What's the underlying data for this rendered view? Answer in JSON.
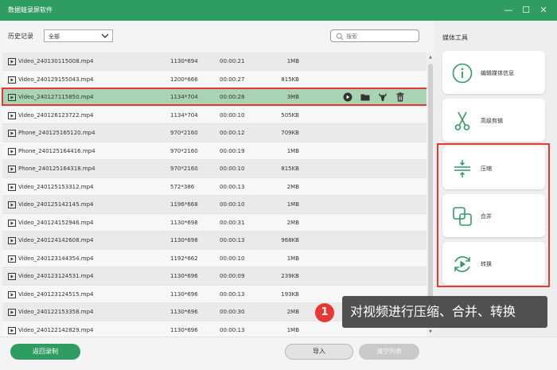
{
  "window": {
    "title": "数据蛙录屏软件",
    "minimize_glyph": "—",
    "maximize_glyph": "☐",
    "close_glyph": "✕"
  },
  "toolbar": {
    "history_label": "历史记录",
    "filter_value": "全部",
    "search_placeholder": "搜索"
  },
  "files": [
    {
      "name": "Video_240130115008.mp4",
      "resolution": "1130*694",
      "duration": "00:00:21",
      "size": "1MB"
    },
    {
      "name": "Video_240129155043.mp4",
      "resolution": "1200*666",
      "duration": "00:00:27",
      "size": "815KB"
    },
    {
      "name": "Video_240127115850.mp4",
      "resolution": "1134*704",
      "duration": "00:00:28",
      "size": "3MB"
    },
    {
      "name": "Video_240126123722.mp4",
      "resolution": "1134*704",
      "duration": "00:00:10",
      "size": "505KB"
    },
    {
      "name": "Phone_240125165120.mp4",
      "resolution": "970*2160",
      "duration": "00:00:12",
      "size": "709KB"
    },
    {
      "name": "Phone_240125164416.mp4",
      "resolution": "970*2160",
      "duration": "00:00:19",
      "size": "1MB"
    },
    {
      "name": "Phone_240125164318.mp4",
      "resolution": "970*2160",
      "duration": "00:00:10",
      "size": "815KB"
    },
    {
      "name": "Video_240125153312.mp4",
      "resolution": "572*386",
      "duration": "00:00:13",
      "size": "2MB"
    },
    {
      "name": "Video_240125142145.mp4",
      "resolution": "1196*668",
      "duration": "00:00:10",
      "size": "1MB"
    },
    {
      "name": "Video_240124152946.mp4",
      "resolution": "1130*698",
      "duration": "00:00:31",
      "size": "2MB"
    },
    {
      "name": "Video_240124142608.mp4",
      "resolution": "1130*698",
      "duration": "00:00:13",
      "size": "968KB"
    },
    {
      "name": "Video_240123144354.mp4",
      "resolution": "1192*662",
      "duration": "00:00:10",
      "size": "1MB"
    },
    {
      "name": "Video_240123124531.mp4",
      "resolution": "1130*696",
      "duration": "00:00:09",
      "size": "239KB"
    },
    {
      "name": "Video_240123124515.mp4",
      "resolution": "1130*696",
      "duration": "00:00:13",
      "size": "193KB"
    },
    {
      "name": "Video_240122153358.mp4",
      "resolution": "1130*696",
      "duration": "00:00:30",
      "size": "2MB"
    },
    {
      "name": "Video_240122142829.mp4",
      "resolution": "1130*696",
      "duration": "00:00:13",
      "size": "1MB"
    }
  ],
  "media_tools": {
    "title": "媒体工具",
    "items": [
      {
        "label": "编辑媒体信息",
        "icon": "info-icon"
      },
      {
        "label": "高级剪辑",
        "icon": "scissors-icon"
      },
      {
        "label": "压缩",
        "icon": "compress-icon"
      },
      {
        "label": "合并",
        "icon": "merge-icon"
      },
      {
        "label": "转换",
        "icon": "convert-icon"
      }
    ]
  },
  "footer": {
    "back_label": "返回录制",
    "import_label": "导入",
    "clear_label": "清空列表"
  },
  "annotation": {
    "step": "1",
    "text": "对视频进行压缩、合并、转换"
  },
  "colors": {
    "brand_green": "#2f9c62",
    "selected_row": "#a9d4b3",
    "highlight_red": "#e53935"
  }
}
